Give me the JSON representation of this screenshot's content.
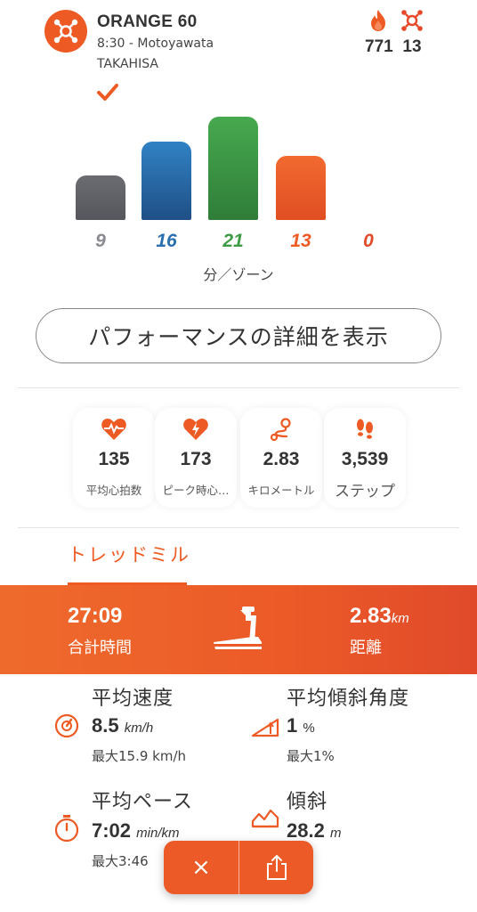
{
  "header": {
    "title": "ORANGE 60",
    "time_location": "8:30 - Motoyawata",
    "coach": "TAKAHISA",
    "calories": "771",
    "splat_points": "13"
  },
  "chart_data": {
    "type": "bar",
    "categories": [
      "grey",
      "blue",
      "green",
      "orange",
      "red"
    ],
    "values": [
      9,
      16,
      21,
      13,
      0
    ],
    "colors": [
      "#5f6066",
      "#2a6fb0",
      "#3d9a45",
      "#ee5a24",
      "#ee5a24"
    ],
    "xlabel": "分／ゾーン"
  },
  "zone_labels": [
    "9",
    "16",
    "21",
    "13",
    "0"
  ],
  "performance_button": "パフォーマンスの詳細を表示",
  "metrics": [
    {
      "value": "135",
      "label": "平均心拍数",
      "icon": "heart-pulse-icon"
    },
    {
      "value": "173",
      "label": "ピーク時心…",
      "icon": "heart-bolt-icon"
    },
    {
      "value": "2.83",
      "label": "キロメートル",
      "icon": "route-icon"
    },
    {
      "value": "3,539",
      "label": "ステップ",
      "icon": "footprints-icon"
    }
  ],
  "tab": "トレッドミル",
  "band": {
    "time": "27:09",
    "time_label": "合計時間",
    "distance": "2.83",
    "distance_unit": "km",
    "distance_label": "距離"
  },
  "stats": {
    "avg_speed": {
      "title": "平均速度",
      "value": "8.5",
      "unit": "km/h",
      "sub": "最大15.9 km/h"
    },
    "avg_incline": {
      "title": "平均傾斜角度",
      "value": "1",
      "unit": "%",
      "sub": "最大1%"
    },
    "avg_pace": {
      "title": "平均ペース",
      "value": "7:02",
      "unit": "min/km",
      "sub": "最大3:46"
    },
    "elevation": {
      "title": "傾斜",
      "value": "28.2",
      "unit": "m"
    }
  },
  "fab": {
    "close": "×"
  },
  "colors": {
    "accent": "#ee5a24",
    "grey": "#5f6066",
    "blue": "#2a6fb0",
    "green": "#3d9a45"
  }
}
